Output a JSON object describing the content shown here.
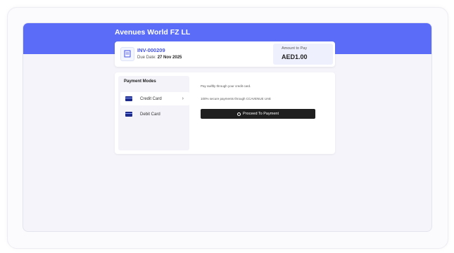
{
  "header": {
    "merchant_name": "Avenues World FZ LL"
  },
  "invoice": {
    "number": "INV-000209",
    "due_label": "Due Date:",
    "due_date": "27 Nov 2025",
    "amount_label": "Amount to Pay",
    "amount_value": "AED1.00"
  },
  "payment": {
    "modes_title": "Payment Modes",
    "modes": [
      {
        "label": "Credit Card",
        "selected": true
      },
      {
        "label": "Debit Card",
        "selected": false
      }
    ],
    "description": "Pay swiftly through your credit card.",
    "secure_note": "100% secure payments through CCAVENUE UAE",
    "proceed_label": "Proceed To Payment"
  },
  "colors": {
    "brand": "#5b6df8",
    "button": "#1f1f1f",
    "invoice_link": "#4453e6"
  }
}
